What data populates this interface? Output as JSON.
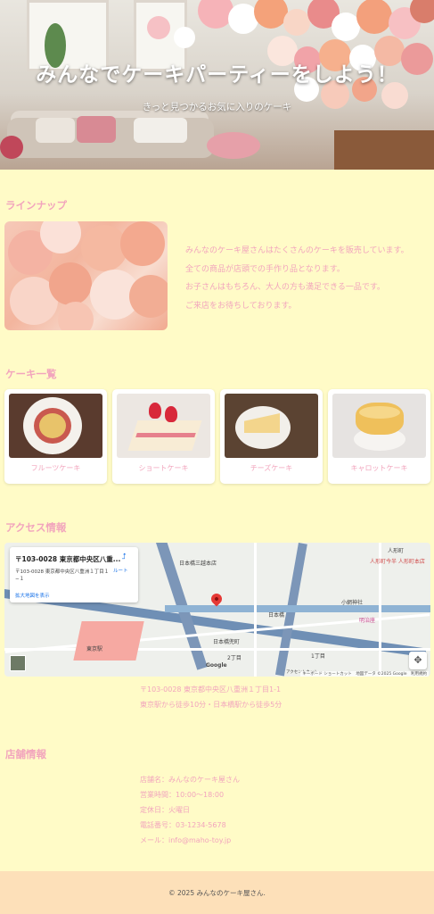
{
  "hero": {
    "title": "みんなでケーキパーティーをしよう！",
    "subtitle": "きっと見つかるお気に入りのケーキ"
  },
  "lineup": {
    "heading": "ラインナップ",
    "lines": [
      "みんなのケーキ屋さんはたくさんのケーキを販売しています。",
      "全ての商品が店頭での手作り品となります。",
      "お子さんはもちろん、大人の方も満足できる一品です。",
      "ご来店をお待ちしております。"
    ]
  },
  "cakes": {
    "heading": "ケーキ一覧",
    "items": [
      {
        "label": "フルーツケーキ"
      },
      {
        "label": "ショートケーキ"
      },
      {
        "label": "チーズケーキ"
      },
      {
        "label": "キャロットケーキ"
      }
    ]
  },
  "access": {
    "heading": "アクセス情報",
    "map": {
      "card_title": "〒103-0028 東京都中央区八重...",
      "card_address": "〒103-0028 東京都中央区八重洲１丁目１−１",
      "card_link": "拡大地図を表示",
      "route_label": "ルート",
      "place_labels": [
        "日本橋三越本店",
        "日本橋",
        "人形町",
        "日本橋兜町",
        "小網神社",
        "東京駅",
        "人形町今半 人形町本店",
        "明治座",
        "アクセントカット",
        "1丁目",
        "2丁目",
        "Google"
      ],
      "attribution": "キーボード ショートカット　地図データ ©2025 Google　利用規約"
    },
    "lines": [
      "〒103-0028 東京都中央区八重洲１丁目1-1",
      "東京駅から徒歩10分・日本橋駅から徒歩5分"
    ]
  },
  "store": {
    "heading": "店舗情報",
    "lines": [
      "店舗名：みんなのケーキ屋さん",
      "営業時間：10:00〜18:00",
      "定休日：火曜日",
      "電話番号：03-1234-5678",
      "メール：info@maho-toy.jp"
    ]
  },
  "footer": {
    "copyright": "© 2025 みんなのケーキ屋さん."
  },
  "colors": {
    "background": "#fffbc7",
    "accent_pink": "#f2a5bd",
    "footer_bg": "#fde0b9"
  }
}
